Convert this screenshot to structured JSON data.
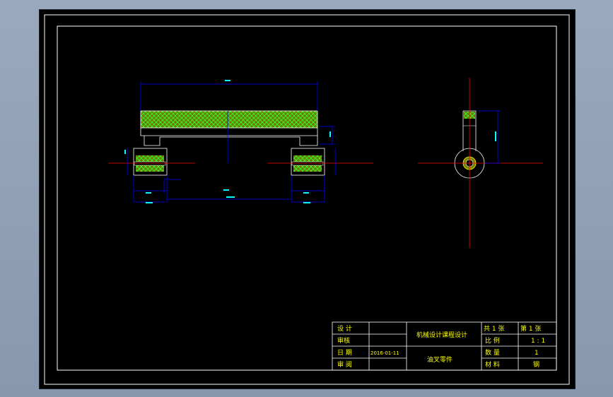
{
  "colors": {
    "background": "#000000",
    "frame": "#ffffff",
    "dimension": "#0000ff",
    "centerline": "#ff0000",
    "hatch": "#00ff00",
    "fill": "#7f7f00",
    "title_text": "#ffff00"
  },
  "title_block": {
    "labels": [
      "设 计",
      "审核",
      "日 期",
      "审 阅"
    ],
    "date_value": "2016-01-11",
    "project": "机械设计课程设计",
    "part_name": "油叉零件",
    "sheet_label": "共 1 张",
    "sheet_no": "第 1 张",
    "scale_label": "比 例",
    "scale_value": "1 : 1",
    "qty_label": "数 量",
    "qty_value": "1",
    "material_label": "材 料",
    "material_value": "钢"
  }
}
